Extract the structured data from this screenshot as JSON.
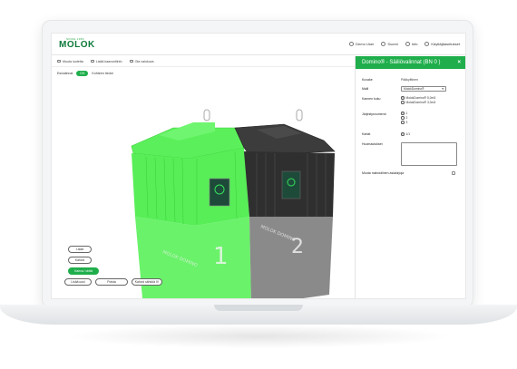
{
  "brand": {
    "tagline": "SINCE 1983",
    "name": "MOLOK"
  },
  "topnav": [
    {
      "icon": "user-icon",
      "label": "Demo User"
    },
    {
      "icon": "flag-icon",
      "label": "Suomi"
    },
    {
      "icon": "info-icon",
      "label": "Info"
    },
    {
      "icon": "gear-icon",
      "label": "Käyttäjäasetukset"
    }
  ],
  "toolbar": {
    "items": [
      "Muuta luotetta",
      "Lisää kaavontiinfo",
      "Ota valokuva"
    ]
  },
  "subtabs": {
    "tab1": "Esivalinnat",
    "pill": "DS",
    "tab3": "Kohteen tiedot"
  },
  "scene": {
    "bin1_number": "1",
    "bin2_number": "2",
    "engraving": "MOLOK DOMINO",
    "bin1_color": "#55ee55",
    "bin2_color": "#8a8a8a",
    "lid2_color": "#3c3c3c",
    "badge_color": "#1e4a3a"
  },
  "actions": {
    "btn_a": "Lisää",
    "btn_b": "Kahvoi",
    "btn_green": "Kahva / ohitä",
    "btn_c": "Lisää uusi",
    "btn_d": "Poista",
    "btn_e": "Kahvoi sähköä IV"
  },
  "panel": {
    "title": "Domino® - Säiliövalinnat (BN 0 )",
    "fields": {
      "kuvake_label": "Kuvake",
      "kuvake_value": "Pääkylttinen",
      "malli_label": "Malli",
      "malli_value": "MolokDomino®",
      "kansi_label": "Kannen kuku",
      "kansi_opt1": "MolokDomino® 5,0m3",
      "kansi_opt2": "MolokDomino® 3,0m3",
      "jarj_label": "Järjestysnumerot",
      "jarj_opt1": "1",
      "jarj_opt2": "2",
      "jarj_opt3": "3",
      "kartat_label": "Kartat",
      "kartat_value": "1/1",
      "huom_label": "Huomautukset",
      "muuta_label": "Muuta mahdollinen asiakirjoja"
    }
  }
}
